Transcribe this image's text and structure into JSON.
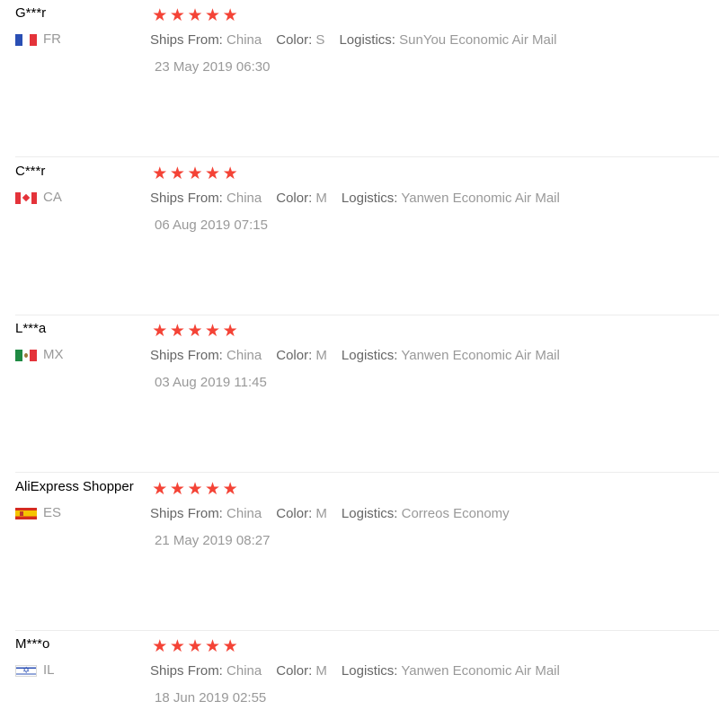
{
  "labels": {
    "ships_from": "Ships From:",
    "color": "Color:",
    "logistics": "Logistics:"
  },
  "star_glyph": "★",
  "accent_color": "#f44336",
  "reviews": [
    {
      "user": "G***r",
      "country": "FR",
      "flag_icon": "france-flag-icon",
      "rating": 5,
      "ships_from": "China",
      "color": "S",
      "logistics": "SunYou Economic Air Mail",
      "date": "23 May 2019 06:30"
    },
    {
      "user": "C***r",
      "country": "CA",
      "flag_icon": "canada-flag-icon",
      "rating": 5,
      "ships_from": "China",
      "color": "M",
      "logistics": "Yanwen Economic Air Mail",
      "date": "06 Aug 2019 07:15"
    },
    {
      "user": "L***a",
      "country": "MX",
      "flag_icon": "mexico-flag-icon",
      "rating": 5,
      "ships_from": "China",
      "color": "M",
      "logistics": "Yanwen Economic Air Mail",
      "date": "03 Aug 2019 11:45"
    },
    {
      "user": "AliExpress Shopper",
      "country": "ES",
      "flag_icon": "spain-flag-icon",
      "rating": 5,
      "ships_from": "China",
      "color": "M",
      "logistics": "Correos Economy",
      "date": "21 May 2019 08:27"
    },
    {
      "user": "M***o",
      "country": "IL",
      "flag_icon": "israel-flag-icon",
      "rating": 5,
      "ships_from": "China",
      "color": "M",
      "logistics": "Yanwen Economic Air Mail",
      "date": "18 Jun 2019 02:55"
    }
  ]
}
